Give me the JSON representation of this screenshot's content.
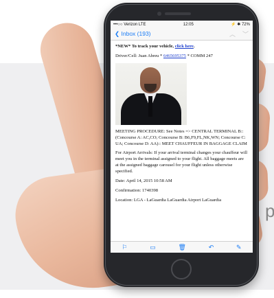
{
  "background_word": "p",
  "status_bar": {
    "carrier": "•••○○ Verizon  LTE",
    "time": "12:05",
    "battery": "⚡ ✱ 72%"
  },
  "nav_bar": {
    "back_label": "Inbox (193)",
    "prev_icon": "chevron-up-icon",
    "next_icon": "chevron-down-icon"
  },
  "email": {
    "new_prefix": "*NEW* To track your vehicle, ",
    "new_link": "click here",
    "new_suffix": ".",
    "driver_prefix": "Driver/Cell: Juan Abreu * ",
    "driver_phone": "6465695375",
    "driver_suffix": " * COMM 247",
    "meeting_procedure": "MEETING PROCEDURE: See Notes => CENTRAL TERMINAL B:: (Concourse A: AC,CO; Concourse B: B6,F9,FL,NK,WN; Concourse C: UA; Concourse D: AA):: MEET CHAUFFEUR IN BAGGAGE CLAIM",
    "airport_arrivals": "For Airport Arrivals: If your arrival terminal changes your chauffeur will meet you in the terminal assigned to your flight. All baggage meets are at the assigned baggage carousel for your flight unless otherwise specified.",
    "date": "Date: April 14, 2015 10:58 AM",
    "confirmation": "Confirmation: 1740398",
    "location": "Location: LGA - LaGuardia LaGuardia Airport LaGuardia"
  },
  "toolbar": {
    "flag_icon": "⚐",
    "folder_icon": "▭",
    "trash_icon": "🗑",
    "reply_icon": "↶",
    "compose_icon": "✎"
  },
  "colors": {
    "ios_blue": "#1a7cf5",
    "link_blue": "#1a3ccc",
    "phone_body": "#26272b"
  }
}
